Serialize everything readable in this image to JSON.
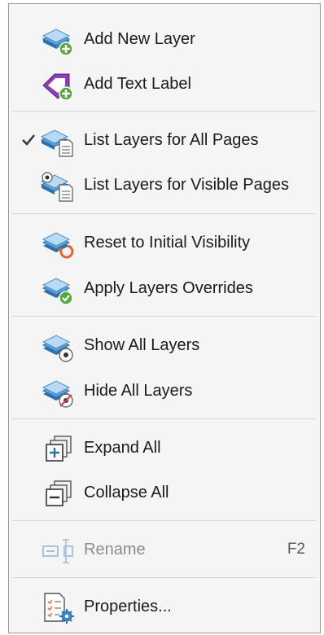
{
  "menu": {
    "items": [
      {
        "label": "Add New Layer",
        "icon": "add-layer-icon"
      },
      {
        "label": "Add Text Label",
        "icon": "add-text-label-icon"
      },
      {
        "label": "List Layers for All Pages",
        "icon": "list-all-pages-icon",
        "checked": true
      },
      {
        "label": "List Layers for Visible Pages",
        "icon": "list-visible-pages-icon"
      },
      {
        "label": "Reset to Initial Visibility",
        "icon": "reset-visibility-icon"
      },
      {
        "label": "Apply Layers Overrides",
        "icon": "apply-overrides-icon"
      },
      {
        "label": "Show All Layers",
        "icon": "show-layers-icon"
      },
      {
        "label": "Hide All Layers",
        "icon": "hide-layers-icon"
      },
      {
        "label": "Expand All",
        "icon": "expand-all-icon"
      },
      {
        "label": "Collapse All",
        "icon": "collapse-all-icon"
      },
      {
        "label": "Rename",
        "icon": "rename-icon",
        "shortcut": "F2",
        "disabled": true
      },
      {
        "label": "Properties...",
        "icon": "properties-icon"
      }
    ]
  },
  "colors": {
    "layer_blue": "#3a86c8",
    "layer_light": "#9bc7ec",
    "green_badge": "#54a93a",
    "purple_tag": "#7a2f9a",
    "orange_arrow": "#e2652a",
    "red_slash": "#d9443a",
    "disabled_text": "#8c8c8c"
  }
}
